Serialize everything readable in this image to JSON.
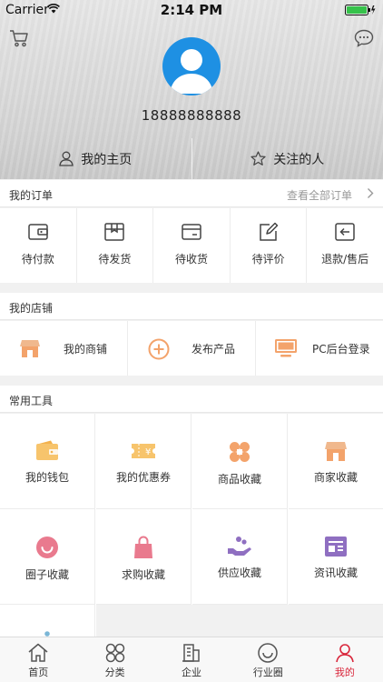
{
  "status_bar": {
    "carrier": "Carrier",
    "time": "2:14 PM"
  },
  "profile": {
    "phone": "18888888888"
  },
  "header_tabs": [
    {
      "label": "我的主页",
      "icon": "user-icon"
    },
    {
      "label": "关注的人",
      "icon": "star-icon"
    }
  ],
  "orders": {
    "title": "我的订单",
    "view_all": "查看全部订单",
    "items": [
      {
        "label": "待付款",
        "icon": "wallet-icon"
      },
      {
        "label": "待发货",
        "icon": "package-icon"
      },
      {
        "label": "待收货",
        "icon": "receive-icon"
      },
      {
        "label": "待评价",
        "icon": "edit-icon"
      },
      {
        "label": "退款/售后",
        "icon": "return-icon"
      }
    ]
  },
  "shop": {
    "title": "我的店铺",
    "items": [
      {
        "label": "我的商铺",
        "icon": "storefront-icon"
      },
      {
        "label": "发布产品",
        "icon": "plus-circle-icon"
      },
      {
        "label": "PC后台登录",
        "icon": "monitor-icon"
      }
    ]
  },
  "tools": {
    "title": "常用工具",
    "items": [
      {
        "label": "我的钱包",
        "icon": "wallet-icon"
      },
      {
        "label": "我的优惠券",
        "icon": "coupon-icon"
      },
      {
        "label": "商品收藏",
        "icon": "flower-icon"
      },
      {
        "label": "商家收藏",
        "icon": "storefront-icon"
      },
      {
        "label": "圈子收藏",
        "icon": "smile-icon"
      },
      {
        "label": "求购收藏",
        "icon": "shopping-bag-icon"
      },
      {
        "label": "供应收藏",
        "icon": "hand-supply-icon"
      },
      {
        "label": "资讯收藏",
        "icon": "news-icon"
      }
    ]
  },
  "tabbar": {
    "items": [
      {
        "label": "首页",
        "icon": "home-icon"
      },
      {
        "label": "分类",
        "icon": "category-icon"
      },
      {
        "label": "企业",
        "icon": "building-icon"
      },
      {
        "label": "行业圈",
        "icon": "circle-icon"
      },
      {
        "label": "我的",
        "icon": "user-icon"
      }
    ],
    "active_index": 4
  },
  "colors": {
    "accent": "#d9263b",
    "avatar_bg": "#1e90e3",
    "orange": "#f3a36b",
    "yellow": "#f7c46c",
    "pink": "#e97a8e",
    "purple": "#8f6fc1"
  }
}
